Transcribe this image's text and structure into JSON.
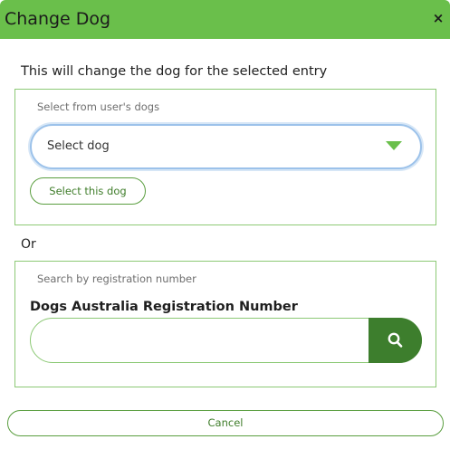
{
  "dialog": {
    "title": "Change Dog",
    "close_symbol": "×",
    "intro": "This will change the dog for the selected entry"
  },
  "user_dogs": {
    "label": "Select from user's dogs",
    "select_value": "Select dog",
    "button_label": "Select this dog"
  },
  "separator": "Or",
  "registration": {
    "label": "Search by registration number",
    "field_label": "Dogs Australia Registration Number",
    "input_value": "",
    "input_placeholder": "",
    "search_icon": "search-icon"
  },
  "footer": {
    "cancel_label": "Cancel"
  },
  "colors": {
    "header_bg": "#6abf4b",
    "accent_dark": "#3d7e2d",
    "panel_border": "#8cc975"
  }
}
